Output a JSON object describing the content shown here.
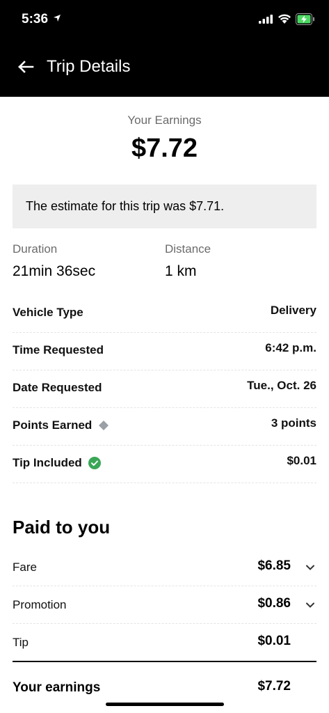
{
  "status_bar": {
    "time": "5:36"
  },
  "header": {
    "title": "Trip Details"
  },
  "summary": {
    "earnings_label": "Your Earnings",
    "earnings_value": "$7.72",
    "estimate_text": "The estimate for this trip was $7.71."
  },
  "stats": {
    "duration_label": "Duration",
    "duration_value": "21min 36sec",
    "distance_label": "Distance",
    "distance_value": "1 km"
  },
  "details": [
    {
      "label": "Vehicle Type",
      "value": "Delivery"
    },
    {
      "label": "Time Requested",
      "value": "6:42 p.m."
    },
    {
      "label": "Date Requested",
      "value": "Tue., Oct. 26"
    },
    {
      "label": "Points Earned",
      "value": "3 points",
      "icon": "diamond-icon"
    },
    {
      "label": "Tip Included",
      "value": "$0.01",
      "icon": "check-circle-icon"
    }
  ],
  "paid": {
    "title": "Paid to you",
    "rows": [
      {
        "label": "Fare",
        "value": "$6.85"
      },
      {
        "label": "Promotion",
        "value": "$0.86"
      },
      {
        "label": "Tip",
        "value": "$0.01"
      }
    ],
    "total_label": "Your earnings",
    "total_value": "$7.72"
  },
  "colors": {
    "header_bg": "#000000",
    "estimate_bg": "#eeeeee",
    "muted_text": "#6b6b6b",
    "check_green": "#3aa757",
    "diamond_gray": "#9aa0a6",
    "battery_green": "#4cd964"
  }
}
